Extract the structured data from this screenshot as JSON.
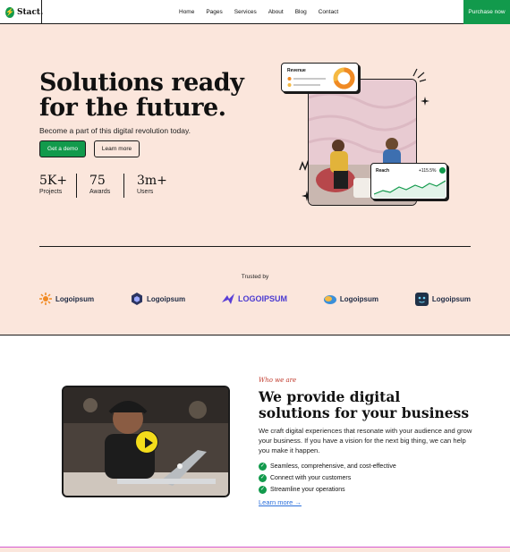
{
  "header": {
    "logo_text": "Stact.",
    "nav": [
      "Home",
      "Pages",
      "Services",
      "About",
      "Blog",
      "Contact"
    ],
    "cta_label": "Purchase now"
  },
  "hero": {
    "title": "Solutions ready for the future.",
    "subtitle": "Become a part of this digital revolution today.",
    "primary_button": "Get a demo",
    "secondary_button": "Learn more",
    "stats": [
      {
        "value": "5K+",
        "label": "Projects"
      },
      {
        "value": "75",
        "label": "Awards"
      },
      {
        "value": "3m+",
        "label": "Users"
      }
    ],
    "revenue_card": {
      "label": "Revenue"
    },
    "reach_card": {
      "label": "Reach",
      "change": "+115.5%"
    }
  },
  "trusted": {
    "label": "Trusted by",
    "logos": [
      "Logoipsum",
      "Logoipsum",
      "LOGOIPSUM",
      "Logoipsum",
      "Logoipsum"
    ]
  },
  "about": {
    "eyebrow": "Who we are",
    "title": "We provide digital solutions for your business",
    "body": "We craft digital experiences that resonate with your audience and grow your business. If you have a vision for the next big thing, we can help you make it happen.",
    "checks": [
      "Seamless, comprehensive, and cost-effective",
      "Connect with your customers",
      "Streamline your operations"
    ],
    "link_label": "Learn more →"
  },
  "colors": {
    "accent_green": "#129a4c",
    "hero_bg": "#fbe6dc",
    "link_blue": "#2a6fdb"
  }
}
